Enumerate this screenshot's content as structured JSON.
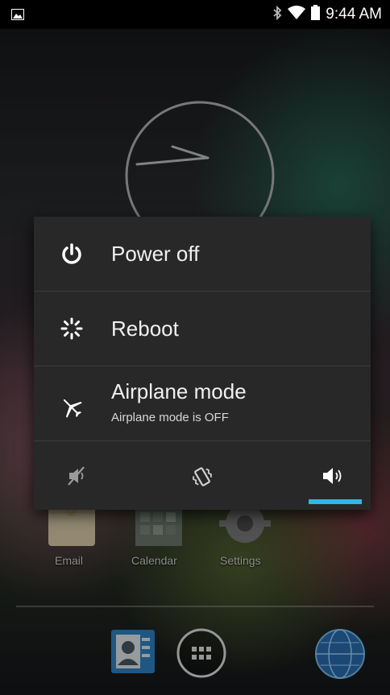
{
  "status_bar": {
    "time": "9:44 AM",
    "icons": [
      "picture-notification-icon",
      "bluetooth-icon",
      "wifi-icon",
      "battery-icon"
    ]
  },
  "home": {
    "apps": [
      {
        "label": "Email",
        "icon": "email-app-icon"
      },
      {
        "label": "Calendar",
        "icon": "calendar-app-icon"
      },
      {
        "label": "Settings",
        "icon": "settings-app-icon"
      }
    ],
    "dock": [
      "people-app-icon",
      "app-drawer-icon",
      "browser-app-icon"
    ]
  },
  "power_menu": {
    "items": [
      {
        "label": "Power off",
        "icon": "power-icon"
      },
      {
        "label": "Reboot",
        "icon": "reboot-icon"
      },
      {
        "label": "Airplane mode",
        "subtitle": "Airplane mode is OFF",
        "icon": "airplane-icon"
      }
    ],
    "sound_modes": [
      {
        "name": "silent",
        "icon": "silent-icon"
      },
      {
        "name": "vibrate",
        "icon": "vibrate-icon"
      },
      {
        "name": "sound",
        "icon": "sound-on-icon"
      }
    ],
    "selected_sound_mode": "sound",
    "accent_color": "#33b5e5"
  }
}
